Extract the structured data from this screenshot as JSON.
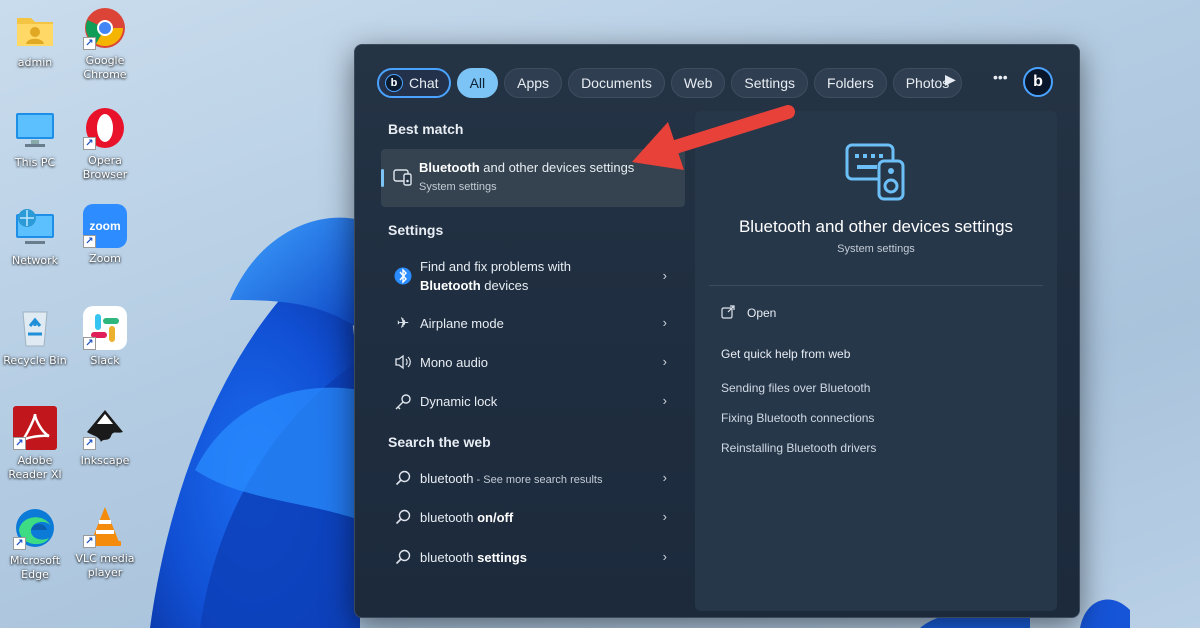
{
  "desktop": {
    "icons": [
      {
        "label": "admin",
        "icon": "user-folder-icon"
      },
      {
        "label": "Google Chrome",
        "icon": "chrome-icon"
      },
      {
        "label": "This PC",
        "icon": "monitor-icon"
      },
      {
        "label": "Opera Browser",
        "icon": "opera-icon"
      },
      {
        "label": "Network",
        "icon": "network-icon"
      },
      {
        "label": "Zoom",
        "icon": "zoom-icon",
        "glyph_text": "zoom"
      },
      {
        "label": "Recycle Bin",
        "icon": "recycle-bin-icon"
      },
      {
        "label": "Slack",
        "icon": "slack-icon"
      },
      {
        "label": "Adobe Reader XI",
        "icon": "adobe-reader-icon"
      },
      {
        "label": "Inkscape",
        "icon": "inkscape-icon"
      },
      {
        "label": "Microsoft Edge",
        "icon": "edge-icon"
      },
      {
        "label": "VLC media player",
        "icon": "vlc-icon"
      }
    ]
  },
  "search": {
    "tabs": [
      {
        "label": "Chat",
        "state": "chat"
      },
      {
        "label": "All",
        "state": "active"
      },
      {
        "label": "Apps"
      },
      {
        "label": "Documents"
      },
      {
        "label": "Web"
      },
      {
        "label": "Settings"
      },
      {
        "label": "Folders"
      },
      {
        "label": "Photos"
      }
    ],
    "best_match": {
      "heading": "Best match",
      "title_bold": "Bluetooth",
      "title_rest": " and other devices settings",
      "subtitle": "System settings"
    },
    "settings": {
      "heading": "Settings",
      "items": [
        {
          "line1": "Find and fix problems with",
          "bold": "Bluetooth",
          "rest": " devices",
          "icon": "bluetooth-icon"
        },
        {
          "label": "Airplane mode",
          "icon": "airplane-icon"
        },
        {
          "label": "Mono audio",
          "icon": "speaker-icon"
        },
        {
          "label": "Dynamic lock",
          "icon": "key-icon"
        }
      ]
    },
    "web": {
      "heading": "Search the web",
      "items": [
        {
          "plain": "bluetooth",
          "bold": "",
          "hint": " - See more search results"
        },
        {
          "plain": "bluetooth ",
          "bold": "on/off",
          "hint": ""
        },
        {
          "plain": "bluetooth ",
          "bold": "settings",
          "hint": ""
        }
      ]
    },
    "preview": {
      "title": "Bluetooth and other devices settings",
      "subtitle": "System settings",
      "open": "Open",
      "help_heading": "Get quick help from web",
      "links": [
        "Sending files over Bluetooth",
        "Fixing Bluetooth connections",
        "Reinstalling Bluetooth drivers"
      ]
    }
  },
  "colors": {
    "accent": "#7cc4f5",
    "arrow": "#e8413a",
    "panel_bg": "#1f2e40"
  }
}
